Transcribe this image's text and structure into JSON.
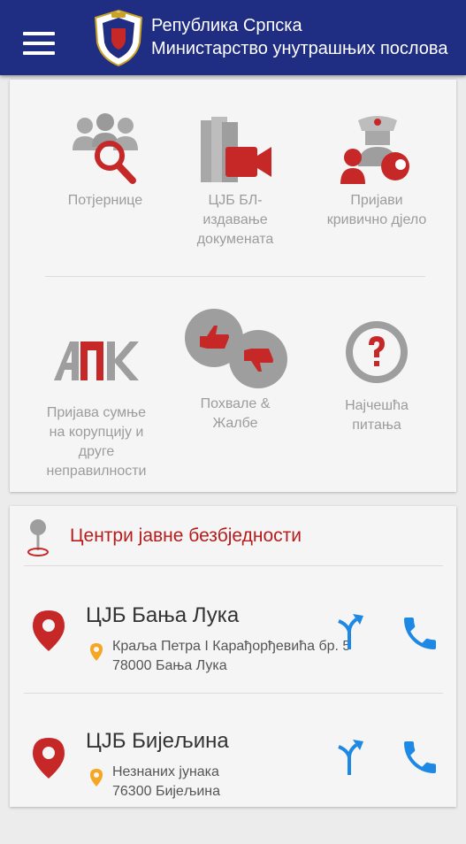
{
  "header": {
    "title_line1": "Република Српска",
    "title_line2": "Министарство унутрашњих послова"
  },
  "tiles": [
    {
      "label_lines": [
        "Потјернице"
      ],
      "icon": "wanted-search-icon"
    },
    {
      "label_lines": [
        "ЦЈБ БЛ-",
        "издавање",
        "докумената"
      ],
      "icon": "documents-video-icon"
    },
    {
      "label_lines": [
        "Пријави",
        "кривично дјело"
      ],
      "icon": "report-crime-icon"
    },
    {
      "label_lines": [
        "Пријава сумње",
        "на корупцију и",
        "друге",
        "неправилности"
      ],
      "icon": "apk-logo-icon"
    },
    {
      "label_lines": [
        "Похвале &",
        "Жалбе"
      ],
      "icon": "thumbs-icon"
    },
    {
      "label_lines": [
        "Најчешћа",
        "питања"
      ],
      "icon": "question-icon"
    }
  ],
  "centers": {
    "title": "Центри јавне безбједности",
    "stations": [
      {
        "name": "ЦЈБ Бања Лука",
        "address_line1": "Краља Петра I Карађорђевића бр. 5",
        "address_line2": "78000 Бања Лука"
      },
      {
        "name": "ЦЈБ Бијељина",
        "address_line1": "Незнаних јунака",
        "address_line2": "76300 Бијељина"
      }
    ]
  },
  "colors": {
    "header_bg": "#1f2d82",
    "accent_red": "#c62828",
    "phone_blue": "#1e88e5",
    "icon_grey": "#9e9e9e",
    "pin_orange": "#f5a623"
  }
}
